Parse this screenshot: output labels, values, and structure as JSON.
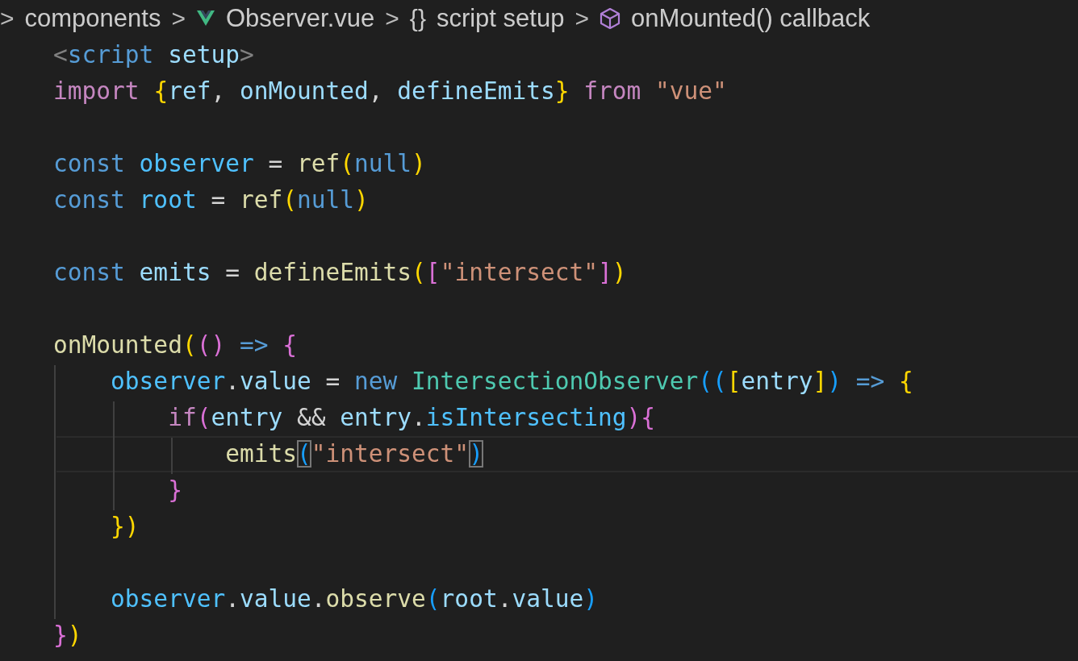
{
  "breadcrumb": [
    {
      "kind": "folder",
      "label": "components"
    },
    {
      "kind": "vue-file",
      "label": "Observer.vue"
    },
    {
      "kind": "braces",
      "icon": "{}",
      "label": "script setup"
    },
    {
      "kind": "method",
      "label": "onMounted() callback"
    }
  ],
  "separator": ">",
  "code_lines": [
    {
      "kind": "code",
      "tokens": [
        {
          "t": "    <",
          "kind": "tag"
        },
        {
          "t": "script ",
          "kind": "keyword"
        },
        {
          "t": "setup",
          "kind": "var"
        },
        {
          "t": ">",
          "kind": "tag"
        }
      ]
    },
    {
      "kind": "code",
      "tokens": [
        {
          "t": "    import ",
          "kind": "control"
        },
        {
          "t": "{",
          "kind": "b1"
        },
        {
          "t": "ref",
          "kind": "var"
        },
        {
          "t": ", ",
          "kind": "plain"
        },
        {
          "t": "onMounted",
          "kind": "var"
        },
        {
          "t": ", ",
          "kind": "plain"
        },
        {
          "t": "defineEmits",
          "kind": "var"
        },
        {
          "t": "} ",
          "kind": "b1"
        },
        {
          "t": "from ",
          "kind": "control"
        },
        {
          "t": "\"vue\"",
          "kind": "string"
        }
      ]
    },
    {
      "kind": "blank"
    },
    {
      "kind": "code",
      "tokens": [
        {
          "t": "    const ",
          "kind": "keyword"
        },
        {
          "t": "observer",
          "kind": "const"
        },
        {
          "t": " = ",
          "kind": "plain"
        },
        {
          "t": "ref",
          "kind": "func"
        },
        {
          "t": "(",
          "kind": "b1"
        },
        {
          "t": "null",
          "kind": "keyword"
        },
        {
          "t": ")",
          "kind": "b1"
        }
      ]
    },
    {
      "kind": "code",
      "tokens": [
        {
          "t": "    const ",
          "kind": "keyword"
        },
        {
          "t": "root",
          "kind": "const"
        },
        {
          "t": " = ",
          "kind": "plain"
        },
        {
          "t": "ref",
          "kind": "func"
        },
        {
          "t": "(",
          "kind": "b1"
        },
        {
          "t": "null",
          "kind": "keyword"
        },
        {
          "t": ")",
          "kind": "b1"
        }
      ]
    },
    {
      "kind": "blank"
    },
    {
      "kind": "code",
      "tokens": [
        {
          "t": "    const ",
          "kind": "keyword"
        },
        {
          "t": "emits",
          "kind": "var"
        },
        {
          "t": " = ",
          "kind": "plain"
        },
        {
          "t": "defineEmits",
          "kind": "func"
        },
        {
          "t": "(",
          "kind": "b1"
        },
        {
          "t": "[",
          "kind": "b2"
        },
        {
          "t": "\"intersect\"",
          "kind": "string"
        },
        {
          "t": "]",
          "kind": "b2"
        },
        {
          "t": ")",
          "kind": "b1"
        }
      ]
    },
    {
      "kind": "blank"
    },
    {
      "kind": "code",
      "tokens": [
        {
          "t": "    onMounted",
          "kind": "func"
        },
        {
          "t": "(",
          "kind": "b1"
        },
        {
          "t": "() ",
          "kind": "b2"
        },
        {
          "t": "=> ",
          "kind": "keyword"
        },
        {
          "t": "{",
          "kind": "b2"
        }
      ]
    },
    {
      "kind": "code",
      "tokens": [
        {
          "t": "        observer",
          "kind": "const"
        },
        {
          "t": ".",
          "kind": "plain"
        },
        {
          "t": "value",
          "kind": "var"
        },
        {
          "t": " = ",
          "kind": "plain"
        },
        {
          "t": "new ",
          "kind": "keyword"
        },
        {
          "t": "IntersectionObserver",
          "kind": "class"
        },
        {
          "t": "((",
          "kind": "b3"
        },
        {
          "t": "[",
          "kind": "b1"
        },
        {
          "t": "entry",
          "kind": "var"
        },
        {
          "t": "]",
          "kind": "b1"
        },
        {
          "t": ") ",
          "kind": "b3"
        },
        {
          "t": "=> ",
          "kind": "keyword"
        },
        {
          "t": "{",
          "kind": "b1"
        }
      ]
    },
    {
      "kind": "code",
      "tokens": [
        {
          "t": "            if",
          "kind": "control"
        },
        {
          "t": "(",
          "kind": "b2"
        },
        {
          "t": "entry",
          "kind": "var"
        },
        {
          "t": " && ",
          "kind": "plain"
        },
        {
          "t": "entry",
          "kind": "var"
        },
        {
          "t": ".",
          "kind": "plain"
        },
        {
          "t": "isIntersecting",
          "kind": "const"
        },
        {
          "t": ")",
          "kind": "b2"
        },
        {
          "t": "{",
          "kind": "b2"
        }
      ]
    },
    {
      "kind": "code",
      "current": true,
      "tokens": [
        {
          "t": "                emits",
          "kind": "func"
        },
        {
          "t": "(",
          "kind": "b3",
          "matched": true
        },
        {
          "t": "\"intersect\"",
          "kind": "string"
        },
        {
          "t": ")",
          "kind": "b3",
          "matched": true
        }
      ]
    },
    {
      "kind": "code",
      "tokens": [
        {
          "t": "            }",
          "kind": "b2"
        }
      ]
    },
    {
      "kind": "code",
      "tokens": [
        {
          "t": "        })",
          "kind": "b1"
        }
      ]
    },
    {
      "kind": "blank"
    },
    {
      "kind": "code",
      "tokens": [
        {
          "t": "        observer",
          "kind": "const"
        },
        {
          "t": ".",
          "kind": "plain"
        },
        {
          "t": "value",
          "kind": "var"
        },
        {
          "t": ".",
          "kind": "plain"
        },
        {
          "t": "observe",
          "kind": "func"
        },
        {
          "t": "(",
          "kind": "b3"
        },
        {
          "t": "root",
          "kind": "var"
        },
        {
          "t": ".",
          "kind": "plain"
        },
        {
          "t": "value",
          "kind": "var"
        },
        {
          "t": ")",
          "kind": "b3"
        }
      ]
    },
    {
      "kind": "code",
      "tokens": [
        {
          "t": "    }",
          "kind": "b2"
        },
        {
          "t": ")",
          "kind": "b1"
        }
      ]
    }
  ]
}
